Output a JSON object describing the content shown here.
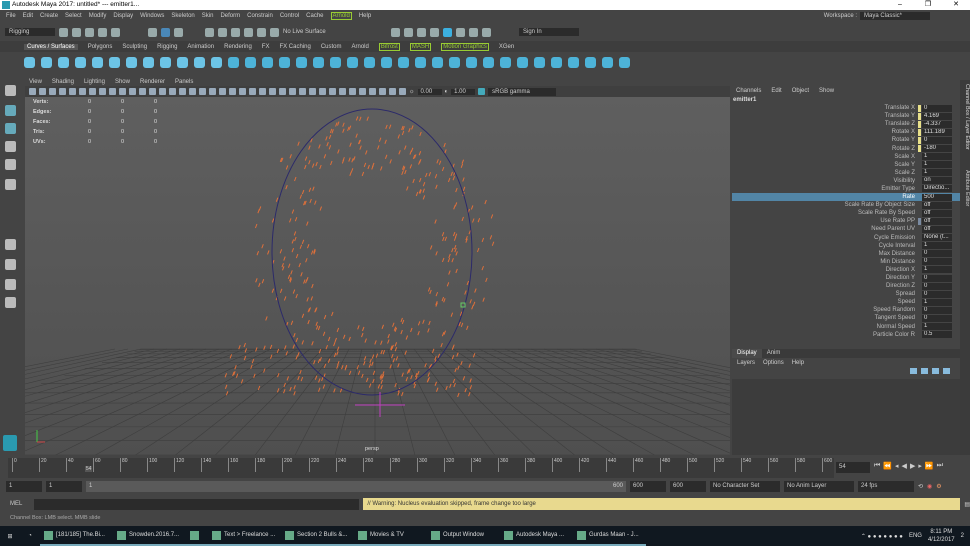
{
  "window": {
    "title": "Autodesk Maya 2017: untitled*   ---   emitter1...",
    "controls": [
      "–",
      "❐",
      "✕"
    ]
  },
  "menu": [
    "File",
    "Edit",
    "Create",
    "Select",
    "Modify",
    "Display",
    "Windows",
    "Skeleton",
    "Skin",
    "Deform",
    "Constrain",
    "Control",
    "Cache",
    "Arnold",
    "Help"
  ],
  "workspace": {
    "label": "Workspace :",
    "value": "Maya Classic*"
  },
  "status": {
    "menuset": "Rigging",
    "live_surface": "No Live Surface",
    "signin": "Sign In"
  },
  "shelf_tabs": [
    "Curves / Surfaces",
    "Polygons",
    "Sculpting",
    "Rigging",
    "Animation",
    "Rendering",
    "FX",
    "FX Caching",
    "Custom",
    "Arnold",
    "Bifrost",
    "MASH",
    "Motion Graphics",
    "XGen"
  ],
  "panel_menu": [
    "View",
    "Shading",
    "Lighting",
    "Show",
    "Renderer",
    "Panels"
  ],
  "panel_toolbar": {
    "exposure": "0.00",
    "gamma": "1.00",
    "colorspace": "sRGB gamma"
  },
  "hud": [
    {
      "label": "Verts:",
      "v": [
        "0",
        "0",
        "0"
      ]
    },
    {
      "label": "Edges:",
      "v": [
        "0",
        "0",
        "0"
      ]
    },
    {
      "label": "Faces:",
      "v": [
        "0",
        "0",
        "0"
      ]
    },
    {
      "label": "Tris:",
      "v": [
        "0",
        "0",
        "0"
      ]
    },
    {
      "label": "UVs:",
      "v": [
        "0",
        "0",
        "0"
      ]
    }
  ],
  "camera": "persp",
  "channel_box": {
    "menu": [
      "Channels",
      "Edit",
      "Object",
      "Show"
    ],
    "object": "emitter1",
    "rows": [
      {
        "n": "Translate X",
        "v": "0",
        "key": "#e8e08a"
      },
      {
        "n": "Translate Y",
        "v": "4.169",
        "key": "#e8e08a"
      },
      {
        "n": "Translate Z",
        "v": "-4.337",
        "key": "#e8e08a"
      },
      {
        "n": "Rotate X",
        "v": "111.189",
        "key": "#e8e08a"
      },
      {
        "n": "Rotate Y",
        "v": "0",
        "key": "#e8e08a"
      },
      {
        "n": "Rotate Z",
        "v": "-180",
        "key": "#e8e08a"
      },
      {
        "n": "Scale X",
        "v": "1"
      },
      {
        "n": "Scale Y",
        "v": "1"
      },
      {
        "n": "Scale Z",
        "v": "1"
      },
      {
        "n": "Visibility",
        "v": "on"
      },
      {
        "n": "Emitter Type",
        "v": "Directio..."
      },
      {
        "n": "Rate",
        "v": "500",
        "sel": true
      },
      {
        "n": "Scale Rate By Object Size",
        "v": "off"
      },
      {
        "n": "Scale Rate By Speed",
        "v": "off"
      },
      {
        "n": "Use Rate PP",
        "v": "off",
        "key": "#7a8aa0"
      },
      {
        "n": "Need Parent UV",
        "v": "off"
      },
      {
        "n": "Cycle Emission",
        "v": "None (t..."
      },
      {
        "n": "Cycle Interval",
        "v": "1"
      },
      {
        "n": "Max Distance",
        "v": "0"
      },
      {
        "n": "Min Distance",
        "v": "0"
      },
      {
        "n": "Direction X",
        "v": "1"
      },
      {
        "n": "Direction Y",
        "v": "0"
      },
      {
        "n": "Direction Z",
        "v": "0"
      },
      {
        "n": "Spread",
        "v": "0"
      },
      {
        "n": "Speed",
        "v": "1"
      },
      {
        "n": "Speed Random",
        "v": "0"
      },
      {
        "n": "Tangent Speed",
        "v": "0"
      },
      {
        "n": "Normal Speed",
        "v": "1"
      },
      {
        "n": "Particle Color R",
        "v": "0.5"
      }
    ]
  },
  "side_tabs": [
    "Channel Box / Layer Editor",
    "Attribute Editor"
  ],
  "layer_editor": {
    "tabs": [
      "Display",
      "Anim"
    ],
    "menu": [
      "Layers",
      "Options",
      "Help"
    ]
  },
  "time_slider": {
    "ticks": [
      "0",
      "20",
      "40",
      "60",
      "80",
      "100",
      "120",
      "140",
      "160",
      "180",
      "200",
      "220",
      "240",
      "260",
      "280",
      "300",
      "320",
      "340",
      "360",
      "380",
      "400",
      "420",
      "440",
      "460",
      "480",
      "500",
      "520",
      "540",
      "560",
      "580",
      "600"
    ],
    "current": "54",
    "current_field": "54",
    "max": 600
  },
  "range": {
    "start": "1",
    "anim_start": "1",
    "range_start": "1",
    "range_end": "600",
    "end": "600",
    "anim_end": "600",
    "character": "No Character Set",
    "anim_layer": "No Anim Layer",
    "fps": "24 fps"
  },
  "command": {
    "lang": "MEL",
    "warning": "// Warning: Nucleus evaluation skipped, frame change too large"
  },
  "help_line": "Channel Box: LMB select. MMB slide",
  "taskbar": {
    "items": [
      "[181/185] The.Bi...",
      "Snowden.2016.7...",
      "",
      "Text > Freelance ...",
      "Section 2 Bulls &...",
      "Movies & TV",
      "Output Window",
      "Autodesk Maya ...",
      "Gurdas Maan - J..."
    ],
    "lang": "ENG",
    "time": "8:11 PM",
    "date": "4/12/2017",
    "notif": "2"
  },
  "colors": {
    "particle": "#e0703a",
    "circle": "#2c2a6a",
    "warning": "#e8d98e",
    "selected": "#5285a6"
  }
}
